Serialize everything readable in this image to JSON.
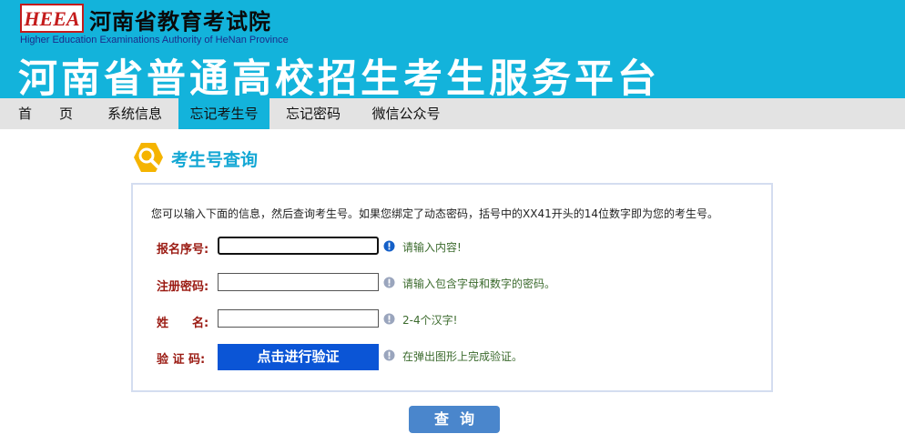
{
  "header": {
    "logo_text": "HEEA",
    "org_name": "河南省教育考试院",
    "org_name_en": "Higher Education Examinations Authority of HeNan Province",
    "platform_title": "河南省普通高校招生考生服务平台",
    "bg_color": "#13b3db"
  },
  "nav": {
    "items": [
      {
        "label": "首　　页"
      },
      {
        "label": "系统信息"
      },
      {
        "label": "忘记考生号"
      },
      {
        "label": "忘记密码"
      },
      {
        "label": "微信公众号"
      }
    ],
    "active_index": 2
  },
  "section": {
    "title": "考生号查询",
    "icon": "search-icon"
  },
  "form": {
    "intro": "您可以输入下面的信息，然后查询考生号。如果您绑定了动态密码，括号中的XX41开头的14位数字即为您的考生号。",
    "fields": [
      {
        "label": "报名序号:",
        "value": "",
        "hint": "请输入内容!",
        "hint_icon": "info-icon-active"
      },
      {
        "label": "注册密码:",
        "value": "",
        "hint": "请输入包含字母和数字的密码。",
        "hint_icon": "info-icon"
      },
      {
        "label": "姓　　名:",
        "value": "",
        "hint": "2-4个汉字!",
        "hint_icon": "info-icon"
      }
    ],
    "captcha": {
      "label": "验 证 码:",
      "button_label": "点击进行验证",
      "hint": "在弹出图形上完成验证。",
      "hint_icon": "info-icon"
    }
  },
  "submit": {
    "label": "查询"
  }
}
